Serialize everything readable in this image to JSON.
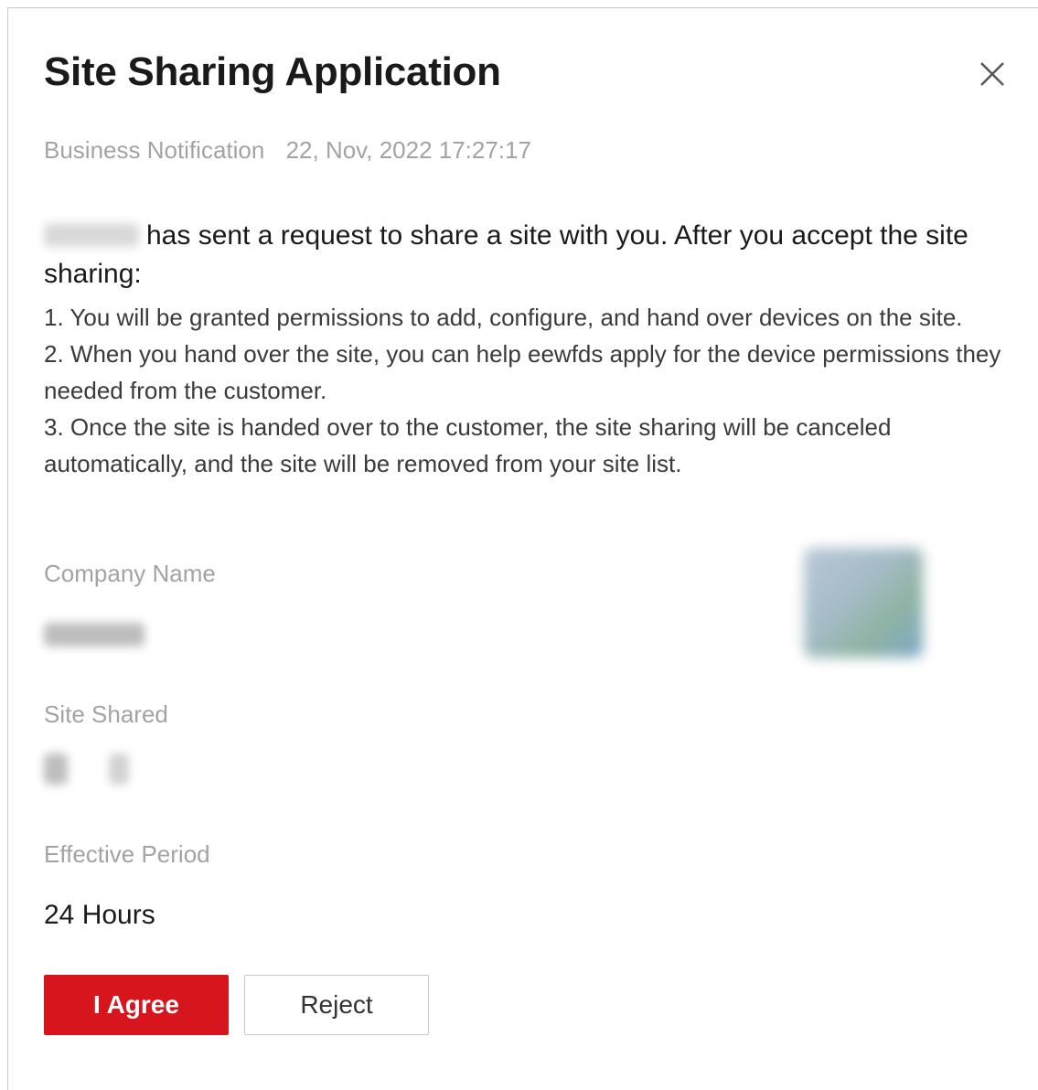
{
  "dialog": {
    "title": "Site Sharing Application",
    "close_icon": "close-icon",
    "meta": {
      "category": "Business Notification",
      "timestamp": "22, Nov, 2022 17:27:17"
    },
    "lead_text": "has sent a request to share a site with you. After you accept the site sharing:",
    "rules": [
      "1. You will be granted permissions to add, configure, and hand over devices on the site.",
      "2. When you hand over the site, you can help eewfds apply for the device permissions they needed from the customer.",
      "3. Once the site is handed over to the customer, the site sharing will be canceled automatically, and the site will be removed from your site list."
    ],
    "fields": {
      "company_name_label": "Company Name",
      "site_shared_label": "Site Shared",
      "effective_period_label": "Effective Period",
      "effective_period_value": "24 Hours"
    },
    "buttons": {
      "agree": "I Agree",
      "reject": "Reject"
    },
    "colors": {
      "primary": "#d7151c",
      "muted_text": "#a3a3a3"
    }
  }
}
